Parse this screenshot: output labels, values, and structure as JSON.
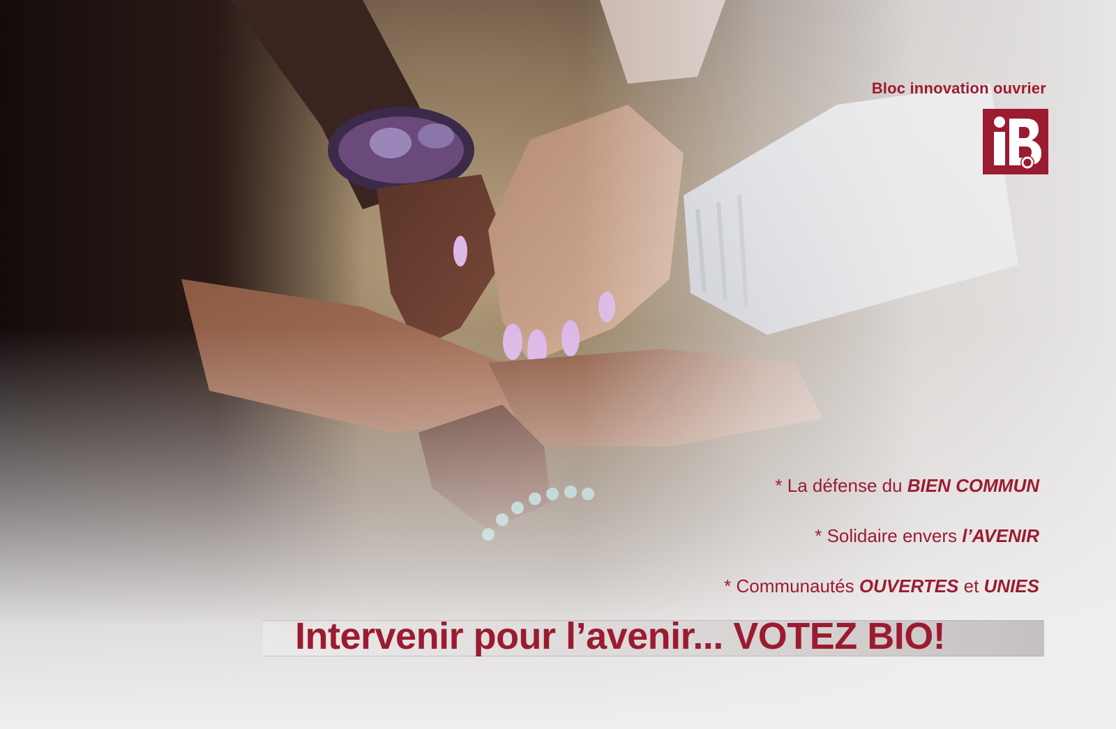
{
  "brand": {
    "name": "Bloc innovation ouvrier",
    "logo_letters": "iBo",
    "colors": {
      "accent": "#9b1b30",
      "background": "#f0efef"
    }
  },
  "bullets": [
    {
      "prefix": "* La défense du ",
      "emphasis": "BIEN COMMUN",
      "suffix": ""
    },
    {
      "prefix": "* Solidaire envers ",
      "emphasis": "l’AVENIR",
      "suffix": ""
    },
    {
      "prefix": "* Communautés ",
      "emphasis": "OUVERTES",
      "middle": " et ",
      "emphasis2": "UNIES"
    }
  ],
  "slogan": "Intervenir pour l’avenir... VOTEZ BIO!"
}
